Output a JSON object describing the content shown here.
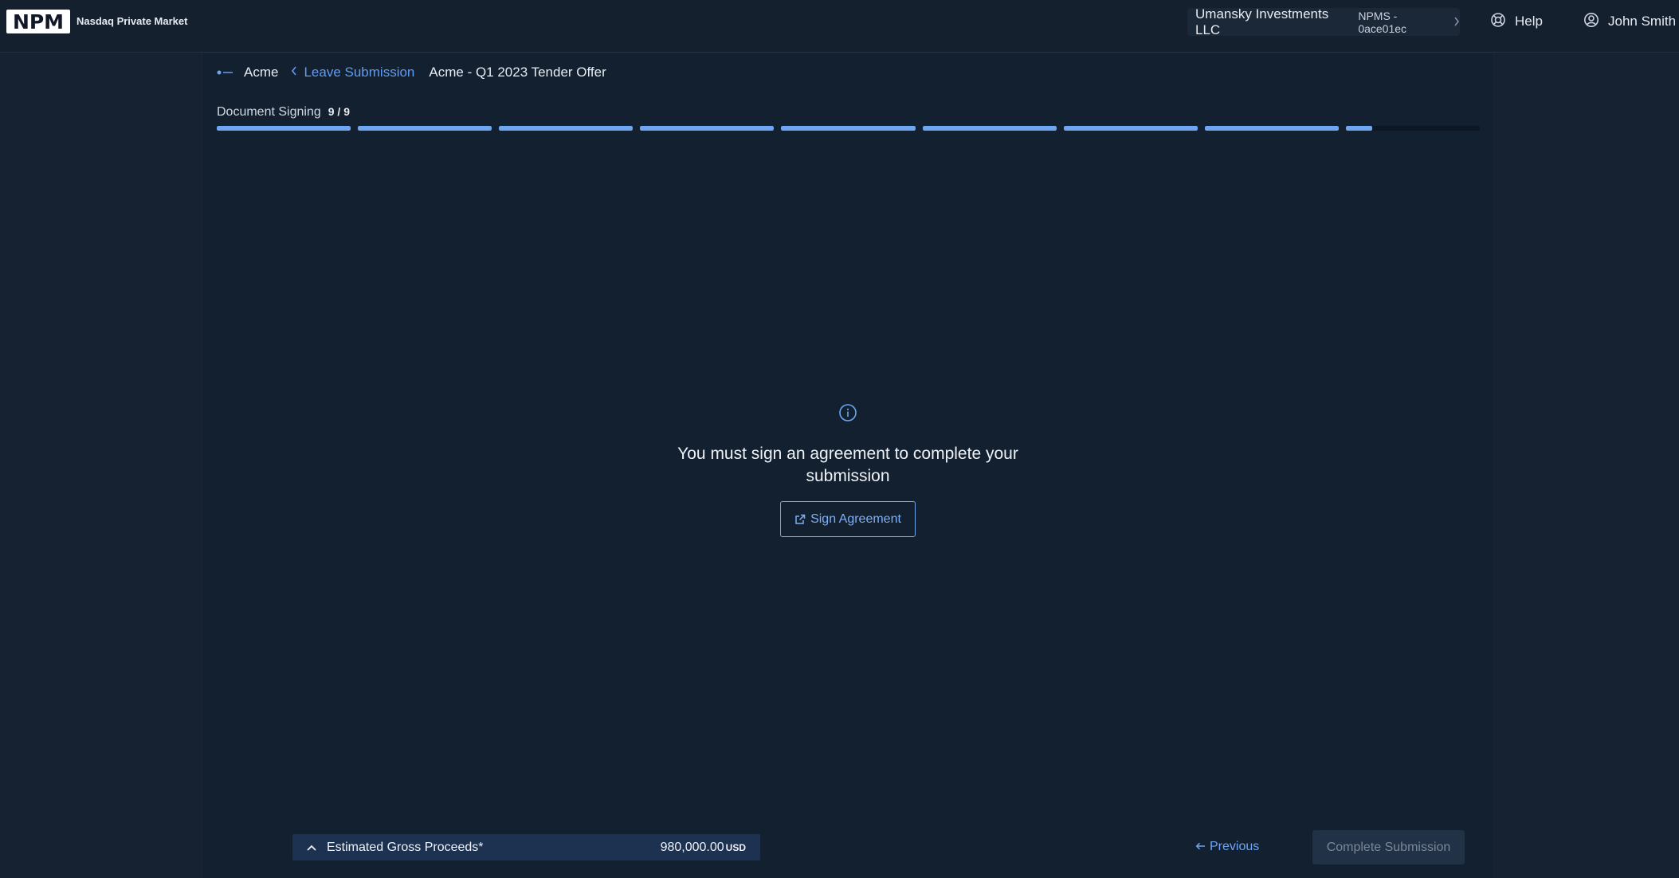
{
  "header": {
    "logo_text": "NPM",
    "brand_name": "Nasdaq Private Market",
    "account": {
      "name": "Umansky Investments LLC",
      "id": "NPMS - 0ace01ec"
    },
    "help_label": "Help",
    "user_name": "John Smith"
  },
  "breadcrumb": {
    "company": "Acme",
    "leave_label": "Leave Submission",
    "title": "Acme - Q1 2023 Tender Offer"
  },
  "step": {
    "label": "Document Signing",
    "count": "9 / 9",
    "segments": 9,
    "current_segment_fill": 0.2
  },
  "center": {
    "message": "You must sign an agreement to complete your submission",
    "sign_button": "Sign Agreement"
  },
  "footer": {
    "proceeds_label": "Estimated Gross Proceeds*",
    "proceeds_value": "980,000.00",
    "proceeds_currency": "USD",
    "previous_label": "Previous",
    "complete_label": "Complete Submission"
  },
  "colors": {
    "background": "#15202f",
    "accent": "#6fa6f2",
    "proceeds_bar": "#1d3250",
    "disabled_button": "#213246"
  }
}
